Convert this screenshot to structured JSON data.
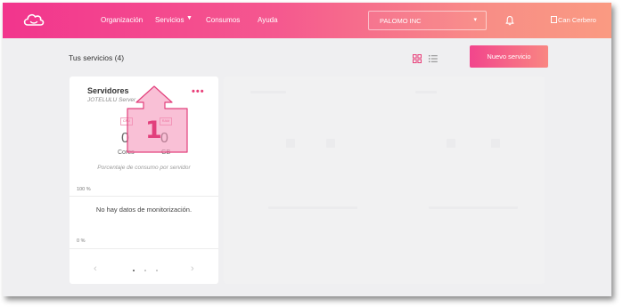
{
  "topbar": {
    "nav": [
      {
        "id": "organizacion",
        "label": "Organización"
      },
      {
        "id": "servicios",
        "label": "Servicios"
      },
      {
        "id": "consumos",
        "label": "Consumos"
      },
      {
        "id": "ayuda",
        "label": "Ayuda"
      }
    ],
    "company_select": {
      "value": "PALOMO INC"
    },
    "avatar_alt": "Can Cerbero",
    "colors": {
      "gradient_start": "#f2358d",
      "gradient_end": "#fa9a82"
    },
    "icons": {
      "logo": "cloud-logo-icon",
      "bell": "bell-icon",
      "caret": "caret-down-icon"
    }
  },
  "toolbar": {
    "title": "Tus servicios (4)",
    "view_icons": [
      "grid-view-icon",
      "list-view-icon"
    ],
    "new_button": "Nuevo servicio"
  },
  "card": {
    "title": "Servidores",
    "subtitle": "JOTELULU Server",
    "menu": "•••",
    "stats": [
      {
        "chip": "CPU",
        "value": "0",
        "unit": "Cores"
      },
      {
        "chip": "RAM",
        "value": "0",
        "unit": "GB"
      }
    ],
    "caption": "Porcentaje de consumo por servidor",
    "axis_top": "100 %",
    "axis_bottom": "0 %",
    "no_data": "No hay datos de monitorización.",
    "pager": {
      "prev": "‹",
      "next": "›",
      "pages": 3,
      "active": 0
    }
  },
  "annotation": {
    "number": "1",
    "color": "#e2407c"
  }
}
